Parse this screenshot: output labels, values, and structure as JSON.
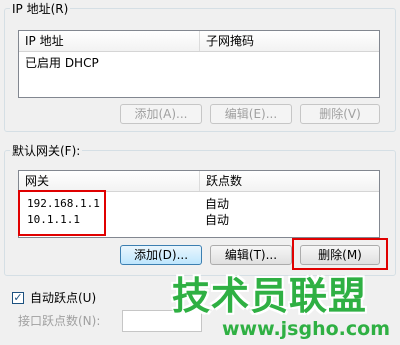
{
  "ip_group": {
    "title": "IP 地址(R)",
    "list_headers": [
      "IP 地址",
      "子网掩码"
    ],
    "rows": [
      [
        "已启用 DHCP",
        ""
      ]
    ],
    "buttons": {
      "add": "添加(A)...",
      "edit": "编辑(E)...",
      "remove": "删除(V)"
    }
  },
  "gateway_group": {
    "title": "默认网关(F):",
    "list_headers": [
      "网关",
      "跃点数"
    ],
    "rows": [
      [
        "192.168.1.1",
        "自动"
      ],
      [
        "10.1.1.1",
        "自动"
      ]
    ],
    "buttons": {
      "add": "添加(D)...",
      "edit": "编辑(T)...",
      "remove": "删除(M)"
    }
  },
  "auto_metric": {
    "checkbox_label": "自动跃点(U)",
    "checked": true,
    "interface_metric_label": "接口跃点数(N):",
    "interface_metric_value": ""
  },
  "watermark": {
    "brand": "技术员联盟",
    "url": "www.jsgho.com"
  },
  "colors": {
    "highlight": "#e00000",
    "watermark": "#2fb043"
  }
}
